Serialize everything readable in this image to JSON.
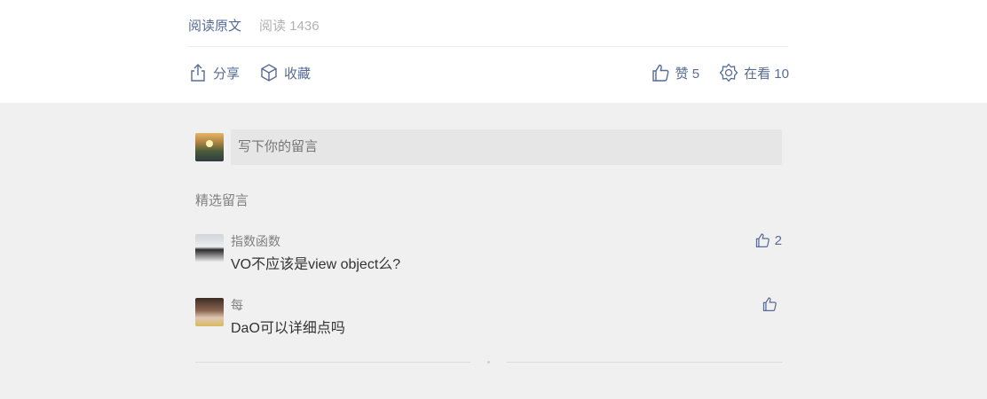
{
  "article_footer": {
    "read_original": "阅读原文",
    "read_count": "阅读 1436",
    "share_label": "分享",
    "favorite_label": "收藏",
    "like_label": "赞 5",
    "watching_label": "在看 10"
  },
  "comment_box": {
    "placeholder": "写下你的留言"
  },
  "comments": {
    "section_title": "精选留言",
    "items": [
      {
        "name": "指数函数",
        "text": "VO不应该是view object么?",
        "likes": "2"
      },
      {
        "name": "每",
        "text": "DaO可以详细点吗",
        "likes": ""
      }
    ]
  },
  "colors": {
    "link": "#576b95",
    "muted": "#b2b2b2",
    "comments_bg": "#f0f0f0"
  },
  "icons": [
    "share-icon",
    "favorite-icon",
    "like-icon",
    "watching-icon",
    "comment-like-icon"
  ]
}
